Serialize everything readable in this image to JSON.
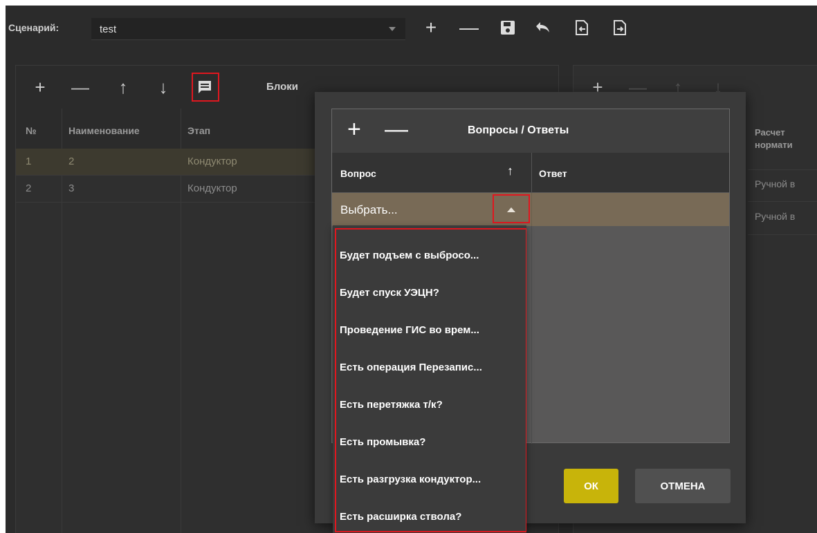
{
  "toolbar": {
    "scenario_label": "Сценарий:",
    "scenario_value": "test",
    "icons": [
      "plus-icon",
      "minus-icon",
      "save-icon",
      "undo-icon",
      "import-icon",
      "export-icon"
    ]
  },
  "blocks_panel": {
    "title": "Блоки",
    "icons": [
      "plus-icon",
      "minus-icon",
      "arrow-up-icon",
      "arrow-down-icon",
      "comment-icon"
    ],
    "columns": [
      "№",
      "Наименование",
      "Этап"
    ],
    "rows": [
      {
        "num": "1",
        "name": "2",
        "stage": "Кондуктор"
      },
      {
        "num": "2",
        "name": "3",
        "stage": "Кондуктор"
      }
    ]
  },
  "right_panel": {
    "column_header_line1": "Расчет",
    "column_header_line2": "нормати",
    "rows": [
      "Ручной в",
      "Ручной в"
    ]
  },
  "dialog": {
    "title": "Вопросы / Ответы",
    "col_question": "Вопрос",
    "col_answer": "Ответ",
    "sort_indicator": "↑",
    "select_value": "Выбрать...",
    "ok_label": "ОК",
    "cancel_label": "ОТМЕНА"
  },
  "dropdown": {
    "items": [
      "Будет подъем с выбросо...",
      "Будет спуск УЭЦН?",
      "Проведение ГИС во врем...",
      "Есть операция Перезапис...",
      "Есть перетяжка т/к?",
      "Есть промывка?",
      "Есть разгрузка кондуктор...",
      "Есть расширка ствола?"
    ]
  },
  "colors": {
    "accent_ok": "#c8b40a",
    "highlight_red": "#e0171f",
    "selected_row": "#786a56"
  }
}
